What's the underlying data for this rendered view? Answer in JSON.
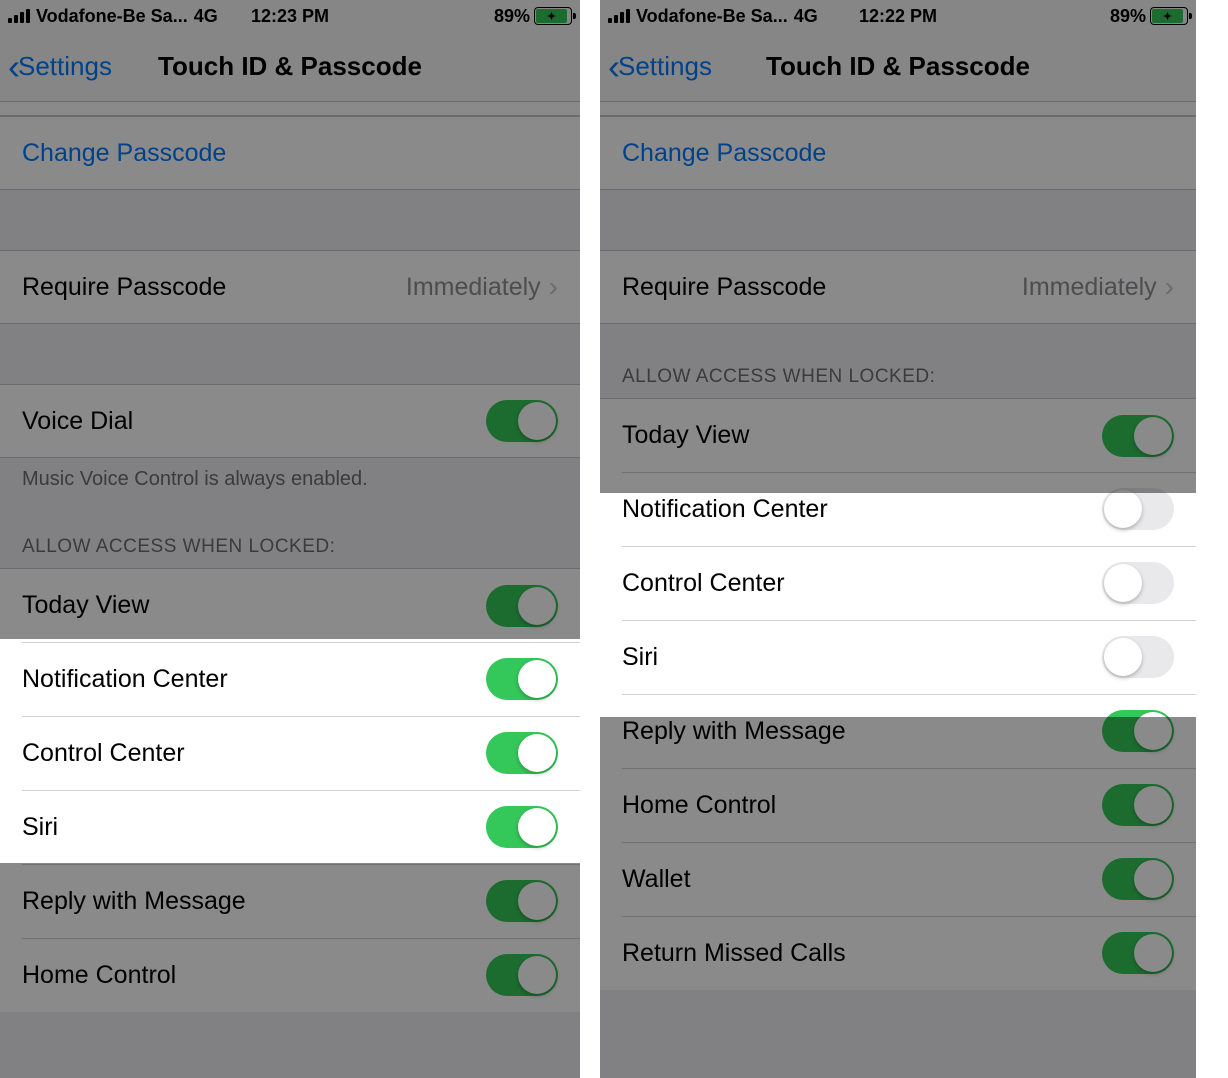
{
  "left": {
    "status": {
      "carrier": "Vodafone-Be Sa...",
      "net": "4G",
      "time": "12:23 PM",
      "battery_pct": "89%"
    },
    "nav": {
      "back": "Settings",
      "title": "Touch ID & Passcode"
    },
    "change_passcode": "Change Passcode",
    "require": {
      "label": "Require Passcode",
      "value": "Immediately"
    },
    "voice_dial": "Voice Dial",
    "voice_note": "Music Voice Control is always enabled.",
    "allow_header": "ALLOW ACCESS WHEN LOCKED:",
    "rows": {
      "today": "Today View",
      "notif": "Notification Center",
      "control": "Control Center",
      "siri": "Siri",
      "reply": "Reply with Message",
      "home": "Home Control"
    }
  },
  "right": {
    "status": {
      "carrier": "Vodafone-Be Sa...",
      "net": "4G",
      "time": "12:22 PM",
      "battery_pct": "89%"
    },
    "nav": {
      "back": "Settings",
      "title": "Touch ID & Passcode"
    },
    "change_passcode": "Change Passcode",
    "require": {
      "label": "Require Passcode",
      "value": "Immediately"
    },
    "allow_header": "ALLOW ACCESS WHEN LOCKED:",
    "rows": {
      "today": "Today View",
      "notif": "Notification Center",
      "control": "Control Center",
      "siri": "Siri",
      "reply": "Reply with Message",
      "home": "Home Control",
      "wallet": "Wallet",
      "missed": "Return Missed Calls"
    }
  }
}
